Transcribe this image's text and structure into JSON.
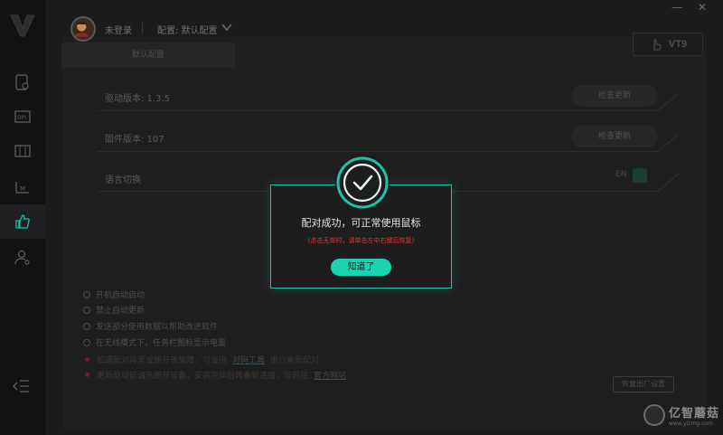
{
  "window": {
    "minimize_label": "—",
    "close_label": "✕"
  },
  "user": {
    "status_label": "未登录",
    "config_label": "配置: 默认配置"
  },
  "config_tab": {
    "label": "默认配置"
  },
  "device": {
    "model": "VT9"
  },
  "settings": {
    "driver_version_label": "驱动版本: 1.3.5",
    "firmware_version_label": "固件版本: 107",
    "language_label": "语言切换",
    "check_update_label": "检查更新",
    "language_value": "EN"
  },
  "options": [
    {
      "label": "开机自动启动"
    },
    {
      "label": "禁止自动更新"
    },
    {
      "label": "发送部分使用数据以帮助改进软件"
    },
    {
      "label": "在无线模式下，任务栏图标显示电量"
    }
  ],
  "notes": {
    "note1_prefix": "如遇配对异常或断开等故障，可使用",
    "note1_link": "对码工具",
    "note1_suffix": "进行重新配对",
    "note2_prefix": "更新驱动前请先断开设备，安装完毕后再重新连接，可前往",
    "note2_link": "官方网站"
  },
  "factory_reset_label": "恢复出厂设置",
  "modal": {
    "title": "配对成功，可正常使用鼠标",
    "subtitle": "(点击无效时，请单击左中右键后恢复)",
    "confirm_label": "知道了"
  },
  "watermark": {
    "title": "亿智蘑菇",
    "url": "www.yizmg.com"
  },
  "colors": {
    "accent": "#18d4b2",
    "warning": "#e03a3a",
    "background": "#161617"
  }
}
